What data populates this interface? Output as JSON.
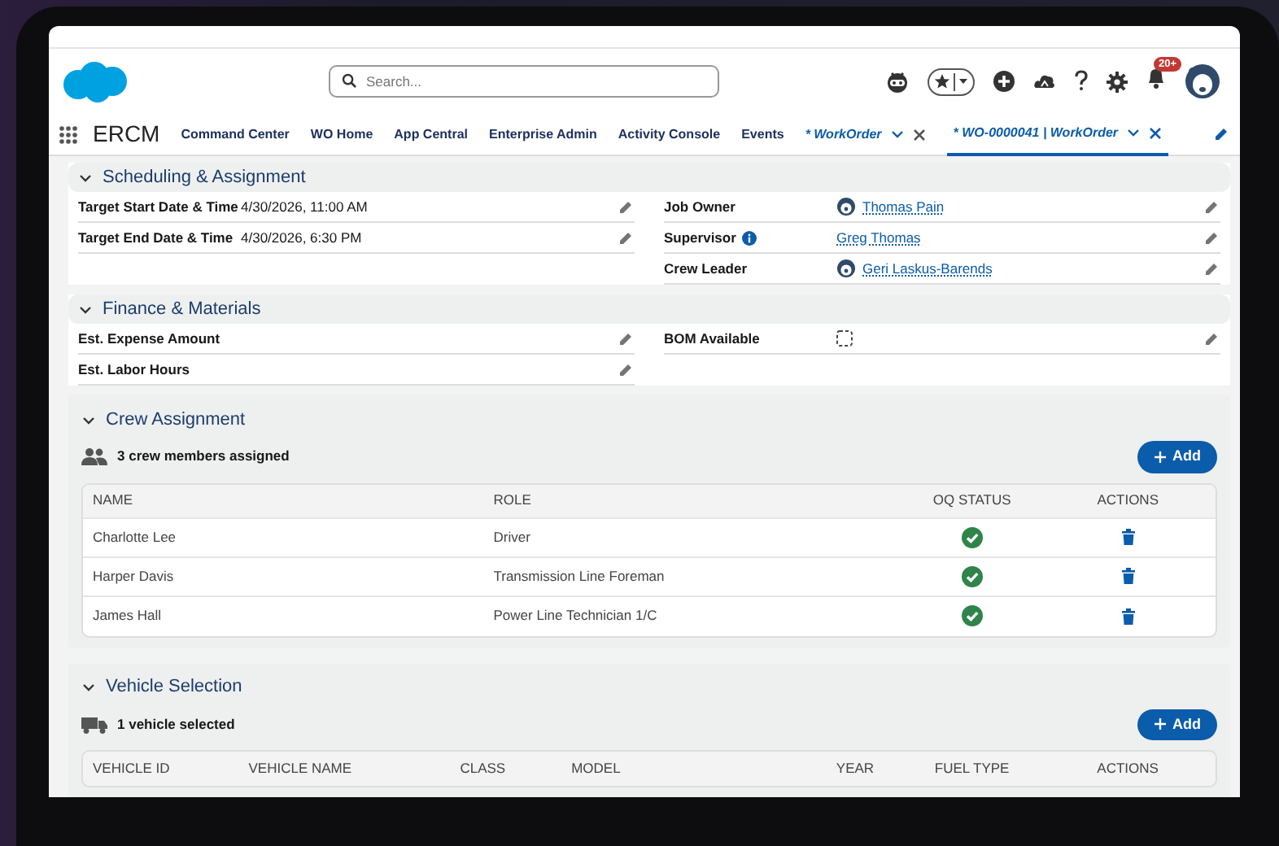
{
  "header": {
    "search": {
      "placeholder": "Search..."
    },
    "notification_count": "20+"
  },
  "app_nav": {
    "app_name": "ERCM",
    "items": [
      {
        "label": "Command Center",
        "kind": "link",
        "selected": false
      },
      {
        "label": "WO Home",
        "kind": "link",
        "selected": false
      },
      {
        "label": "App Central",
        "kind": "link",
        "selected": false
      },
      {
        "label": "Enterprise Admin",
        "kind": "link",
        "selected": false
      },
      {
        "label": "Activity Console",
        "kind": "link",
        "selected": false
      },
      {
        "label": "Events",
        "kind": "link",
        "selected": false
      },
      {
        "label": "* WorkOrder",
        "kind": "tab",
        "selected": false
      },
      {
        "label": "* WO-0000041 | WorkOrder",
        "kind": "tab",
        "selected": true
      }
    ]
  },
  "sections": [
    {
      "kind": "fields",
      "title": "Scheduling & Assignment",
      "expanded": true,
      "left": [
        {
          "label": "Target Start Date & Time",
          "kind": "text",
          "value": "4/30/2026, 11:00 AM"
        },
        {
          "label": "Target End Date & Time",
          "kind": "text",
          "value": "4/30/2026, 6:30 PM"
        }
      ],
      "right": [
        {
          "label": "Job Owner",
          "kind": "user",
          "value": "Thomas Pain"
        },
        {
          "label": "Supervisor",
          "kind": "link",
          "value": "Greg Thomas",
          "info": true
        },
        {
          "label": "Crew Leader",
          "kind": "user",
          "value": "Geri Laskus-Barends"
        }
      ]
    },
    {
      "kind": "fields",
      "title": "Finance & Materials",
      "expanded": true,
      "left": [
        {
          "label": "Est. Expense Amount",
          "kind": "text"
        },
        {
          "label": "Est. Labor Hours",
          "kind": "text"
        }
      ],
      "right": [
        {
          "label": "BOM Available",
          "kind": "checkbox",
          "checked": false
        }
      ]
    },
    {
      "kind": "table",
      "title": "Crew Assignment",
      "expanded": true,
      "summary": {
        "kind": "people",
        "text": "3 crew members assigned"
      },
      "add_button": "Add",
      "columns": [
        "NAME",
        "ROLE",
        "OQ STATUS",
        "ACTIONS"
      ],
      "rows": [
        {
          "cells": [
            "Charlotte Lee",
            "Driver"
          ],
          "qualified": true
        },
        {
          "cells": [
            "Harper Davis",
            "Transmission Line Foreman"
          ],
          "qualified": true
        },
        {
          "cells": [
            "James Hall",
            "Power Line Technician 1/C"
          ],
          "qualified": true
        }
      ]
    },
    {
      "kind": "table",
      "title": "Vehicle Selection",
      "expanded": true,
      "summary": {
        "kind": "vehicle",
        "text": "1 vehicle selected"
      },
      "add_button": "Add",
      "columns": [
        "VEHICLE ID",
        "VEHICLE NAME",
        "CLASS",
        "MODEL",
        "YEAR",
        "FUEL TYPE",
        "ACTIONS"
      ]
    }
  ]
}
